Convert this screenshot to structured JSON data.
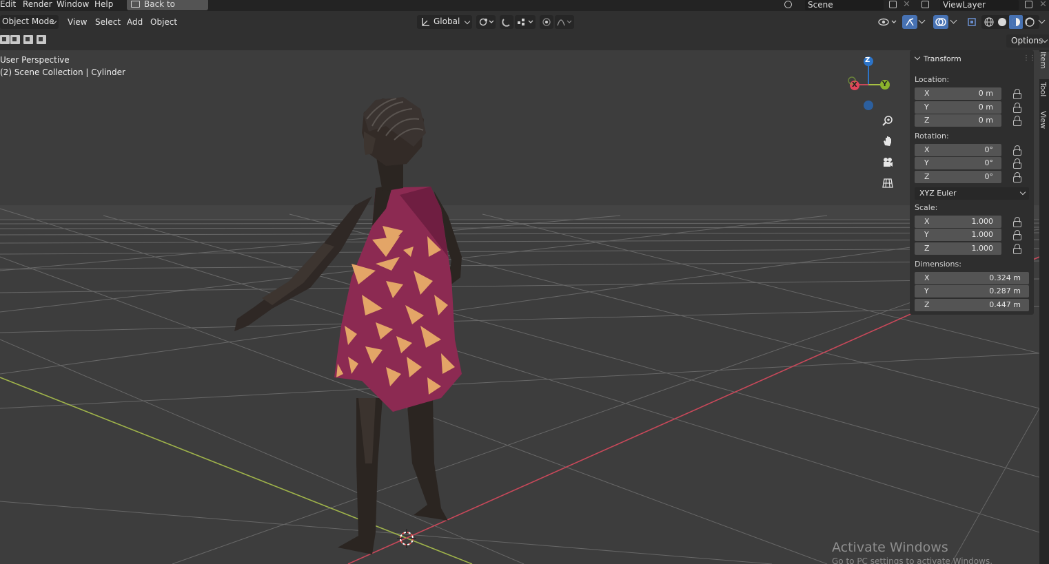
{
  "topbar": {
    "menus": [
      "Edit",
      "Render",
      "Window",
      "Help"
    ],
    "back_button": "Back to Previous",
    "scene": "Scene",
    "view_layer": "ViewLayer"
  },
  "header": {
    "mode": "Object Mode",
    "menus": [
      "View",
      "Select",
      "Add",
      "Object"
    ],
    "transform_orientation": "Global",
    "options": "Options"
  },
  "viewport": {
    "perspective": "User Perspective",
    "collection_info": "(2) Scene Collection | Cylinder",
    "gizmo": {
      "z": "Z",
      "y": "Y",
      "x": "X"
    }
  },
  "npanel": {
    "title": "Transform",
    "location": {
      "label": "Location:",
      "fields": [
        {
          "axis": "X",
          "value": "0 m"
        },
        {
          "axis": "Y",
          "value": "0 m"
        },
        {
          "axis": "Z",
          "value": "0 m"
        }
      ]
    },
    "rotation": {
      "label": "Rotation:",
      "fields": [
        {
          "axis": "X",
          "value": "0°"
        },
        {
          "axis": "Y",
          "value": "0°"
        },
        {
          "axis": "Z",
          "value": "0°"
        }
      ],
      "mode": "XYZ Euler"
    },
    "scale": {
      "label": "Scale:",
      "fields": [
        {
          "axis": "X",
          "value": "1.000"
        },
        {
          "axis": "Y",
          "value": "1.000"
        },
        {
          "axis": "Z",
          "value": "1.000"
        }
      ]
    },
    "dimensions": {
      "label": "Dimensions:",
      "fields": [
        {
          "axis": "X",
          "value": "0.324 m"
        },
        {
          "axis": "Y",
          "value": "0.287 m"
        },
        {
          "axis": "Z",
          "value": "0.447 m"
        }
      ]
    }
  },
  "sidetabs": [
    "Item",
    "Tool",
    "View"
  ],
  "watermark": {
    "title": "Activate Windows",
    "subtitle": "Go to PC settings to activate Windows."
  },
  "colors": {
    "accent": "#4772b3",
    "x_axis": "#c9485a",
    "y_axis": "#a7c043",
    "z_axis": "#2c74c9",
    "dress": "#8c2a52",
    "dress_pattern": "#e3a567"
  }
}
